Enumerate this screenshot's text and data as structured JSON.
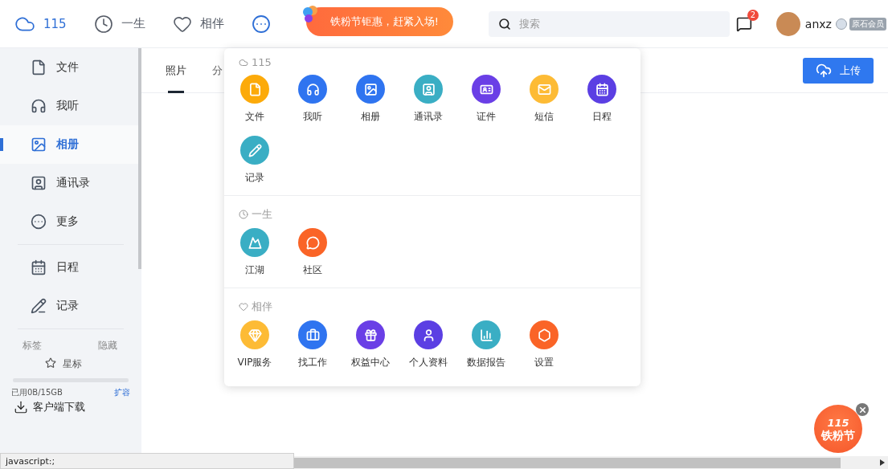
{
  "top_nav": [
    {
      "label": "115",
      "selected": true
    },
    {
      "label": "一生",
      "selected": false
    },
    {
      "label": "相伴",
      "selected": false
    }
  ],
  "promo_banner": {
    "text": "铁粉节钜惠，赶紧入场!"
  },
  "search": {
    "placeholder": "搜索"
  },
  "messages": {
    "badge": "2"
  },
  "user": {
    "name": "anxz",
    "membership": "原石会员"
  },
  "sidebar": {
    "groups": [
      {
        "items": [
          {
            "label": "文件",
            "selected": false
          },
          {
            "label": "我听",
            "selected": false
          },
          {
            "label": "相册",
            "selected": true
          },
          {
            "label": "通讯录",
            "selected": false
          },
          {
            "label": "更多",
            "selected": false
          }
        ]
      },
      {
        "items": [
          {
            "label": "日程",
            "selected": false
          },
          {
            "label": "记录",
            "selected": false
          }
        ]
      }
    ],
    "tags_label": "标签",
    "hide_label": "隐藏",
    "starred": "星标",
    "storage": {
      "used": "已用0B/15GB",
      "level": 0,
      "expand": "扩容"
    },
    "download": "客户端下载"
  },
  "tabs": [
    {
      "label": "照片",
      "selected": true
    },
    {
      "label": "分",
      "selected": false
    }
  ],
  "upload_button": "上传",
  "dropdown": {
    "sections": [
      {
        "title": "115",
        "apps": [
          {
            "label": "文件",
            "color": "#fcaa0a"
          },
          {
            "label": "我听",
            "color": "#2f74f0"
          },
          {
            "label": "相册",
            "color": "#2f74f0"
          },
          {
            "label": "通讯录",
            "color": "#3aaec4"
          },
          {
            "label": "证件",
            "color": "#6a3fe6"
          },
          {
            "label": "短信",
            "color": "#fdbb35"
          },
          {
            "label": "日程",
            "color": "#5b3fe3"
          },
          {
            "label": "记录",
            "color": "#3aaec4"
          }
        ]
      },
      {
        "title": "一生",
        "apps": [
          {
            "label": "江湖",
            "color": "#3aaec4"
          },
          {
            "label": "社区",
            "color": "#fa6427"
          }
        ]
      },
      {
        "title": "相伴",
        "apps": [
          {
            "label": "VIP服务",
            "color": "#fdbb35"
          },
          {
            "label": "找工作",
            "color": "#2f74f0"
          },
          {
            "label": "权益中心",
            "color": "#6a3fe6"
          },
          {
            "label": "个人资料",
            "color": "#5b3fe3"
          },
          {
            "label": "数据报告",
            "color": "#3aaec4"
          },
          {
            "label": "设置",
            "color": "#fa6427"
          }
        ]
      }
    ]
  },
  "floating_promo": {
    "number": "115",
    "text": "铁粉节"
  },
  "status_bar": "javascript:;"
}
